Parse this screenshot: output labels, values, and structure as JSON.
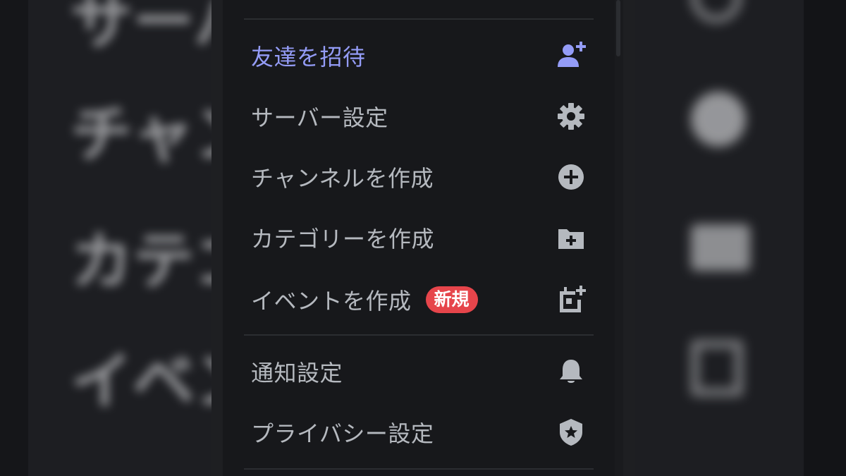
{
  "menu": {
    "items": [
      {
        "label": "友達を招待",
        "icon": "invite-friend-icon",
        "color": "#949cf7"
      },
      {
        "label": "サーバー設定",
        "icon": "gear-icon"
      },
      {
        "label": "チャンネルを作成",
        "icon": "plus-circle-icon"
      },
      {
        "label": "カテゴリーを作成",
        "icon": "folder-plus-icon"
      },
      {
        "label": "イベントを作成",
        "icon": "calendar-plus-icon",
        "badge": "新規",
        "badge_color": "#e6454b"
      },
      {
        "label": "通知設定",
        "icon": "bell-icon"
      },
      {
        "label": "プライバシー設定",
        "icon": "shield-star-icon"
      }
    ]
  },
  "background": {
    "left_texts": [
      "サーバ",
      "チャン",
      "カテゴ",
      "イベン"
    ]
  },
  "colors": {
    "menu_bg": "#17181b",
    "text": "#b5b9bf",
    "accent": "#949cf7",
    "badge": "#e6454b"
  }
}
